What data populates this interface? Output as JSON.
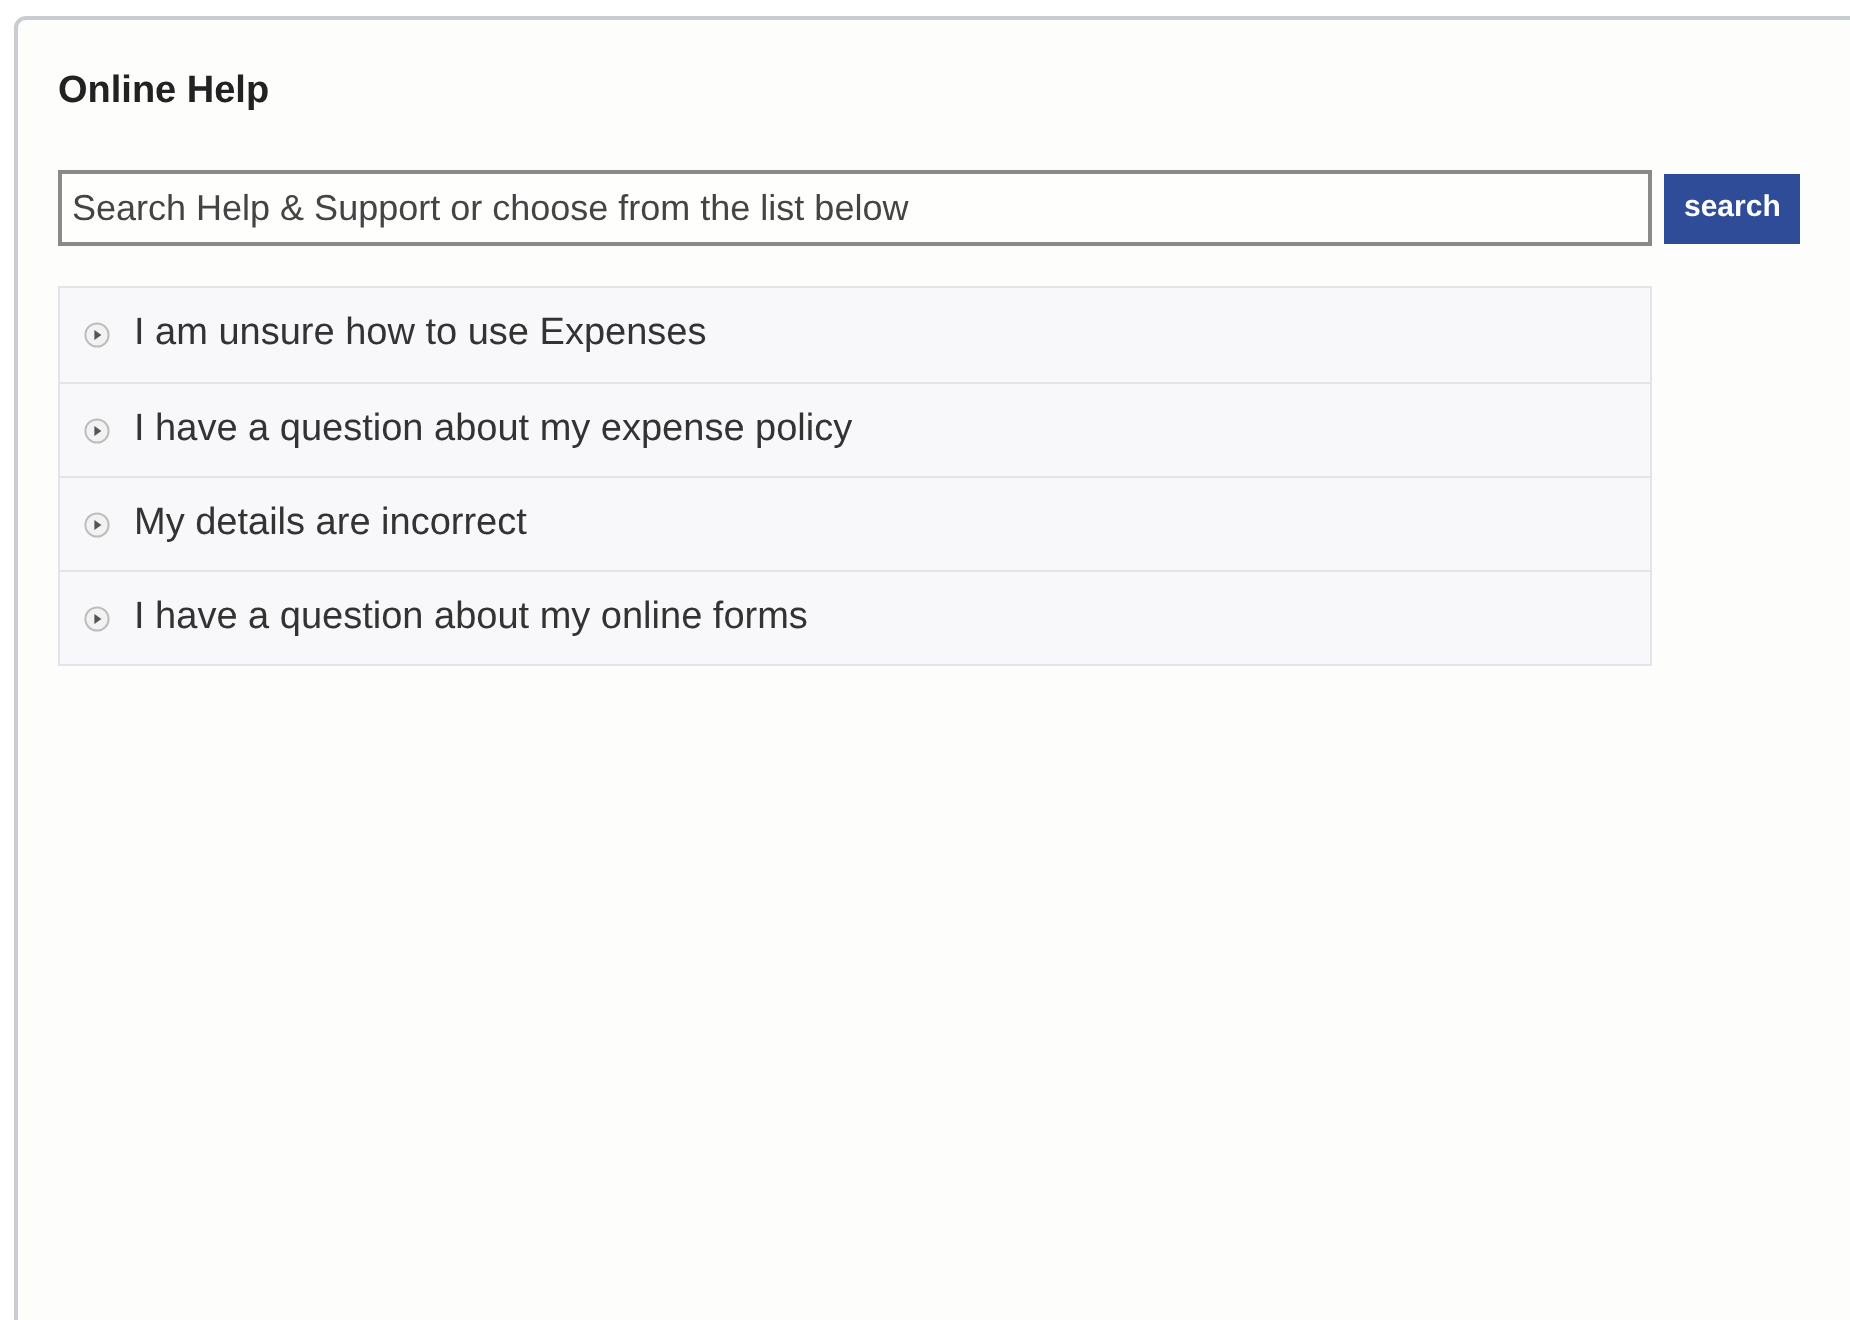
{
  "panel": {
    "title": "Online Help"
  },
  "search": {
    "placeholder": "Search Help & Support or choose from the list below",
    "button": "search"
  },
  "topics": [
    {
      "label": "I am unsure how to use Expenses",
      "expanded": false
    },
    {
      "label": "I have a question about my expense policy",
      "expanded": false
    },
    {
      "label": "My details are incorrect",
      "expanded": false
    },
    {
      "label": "I have a question about my online forms",
      "expanded": false
    }
  ]
}
